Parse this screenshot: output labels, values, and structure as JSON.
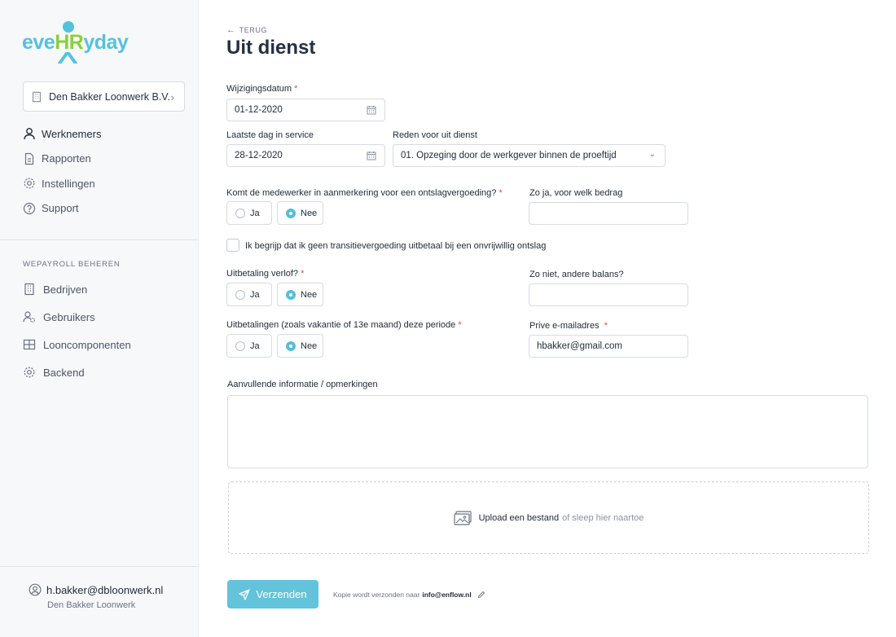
{
  "app": {
    "logo_pre": "eve",
    "logo_hr": "HR",
    "logo_post": "yday"
  },
  "sidebar": {
    "company": "Den Bakker Loonwerk B.V.",
    "nav": [
      {
        "label": "Werknemers",
        "icon": "user-icon"
      },
      {
        "label": "Rapporten",
        "icon": "document-icon"
      },
      {
        "label": "Instellingen",
        "icon": "gear-icon"
      },
      {
        "label": "Support",
        "icon": "help-icon"
      }
    ],
    "section_title": "WEPAYROLL BEHEREN",
    "nav2": [
      {
        "label": "Bedrijven",
        "icon": "building-icon"
      },
      {
        "label": "Gebruikers",
        "icon": "users-gear-icon"
      },
      {
        "label": "Looncomponenten",
        "icon": "grid-icon"
      },
      {
        "label": "Backend",
        "icon": "gear-icon"
      }
    ],
    "user": {
      "email": "h.bakker@dbloonwerk.nl",
      "company": "Den Bakker Loonwerk"
    }
  },
  "header": {
    "back_label": "TERUG",
    "title": "Uit dienst"
  },
  "form": {
    "change_date": {
      "label": "Wijzigingsdatum",
      "value": "01-12-2020"
    },
    "last_day": {
      "label": "Laatste dag in service",
      "value": "28-12-2020"
    },
    "reason": {
      "label": "Reden voor uit dienst",
      "value": "01. Opzeging door de werkgever binnen de proeftijd"
    },
    "severance": {
      "label": "Komt de medewerker in aanmerkering voor een ontslagvergoeding?",
      "selected": "Nee"
    },
    "severance_amount": {
      "label": "Zo ja, voor welk bedrag",
      "value": ""
    },
    "acknowledge": {
      "label": "Ik begrijp dat ik geen transitievergoeding uitbetaal bij een onvrijwillig ontslag",
      "checked": false
    },
    "leave_payout": {
      "label": "Uitbetaling verlof?",
      "selected": "Nee"
    },
    "other_balance": {
      "label": "Zo niet, andere balans?",
      "value": ""
    },
    "payouts": {
      "label": "Uitbetalingen (zoals vakantie of 13e maand) deze periode",
      "selected": "Nee"
    },
    "email": {
      "label": "Prive e-mailadres",
      "value": "hbakker@gmail.com"
    },
    "remarks": {
      "label": "Aanvullende informatie / opmerkingen",
      "value": ""
    },
    "yes_label": "Ja",
    "no_label": "Nee",
    "required_mark": "*"
  },
  "upload": {
    "link": "Upload een bestand",
    "rest": "of sleep hier naartoe"
  },
  "submit": {
    "label": "Verzenden",
    "note_prefix": "Kopie wordt verzonden naar",
    "note_email": "info@enflow.nl"
  },
  "colors": {
    "accent": "#63c3da",
    "logo_blue": "#55c2dd",
    "logo_green": "#8ccf3f",
    "required": "#e24b4b"
  }
}
